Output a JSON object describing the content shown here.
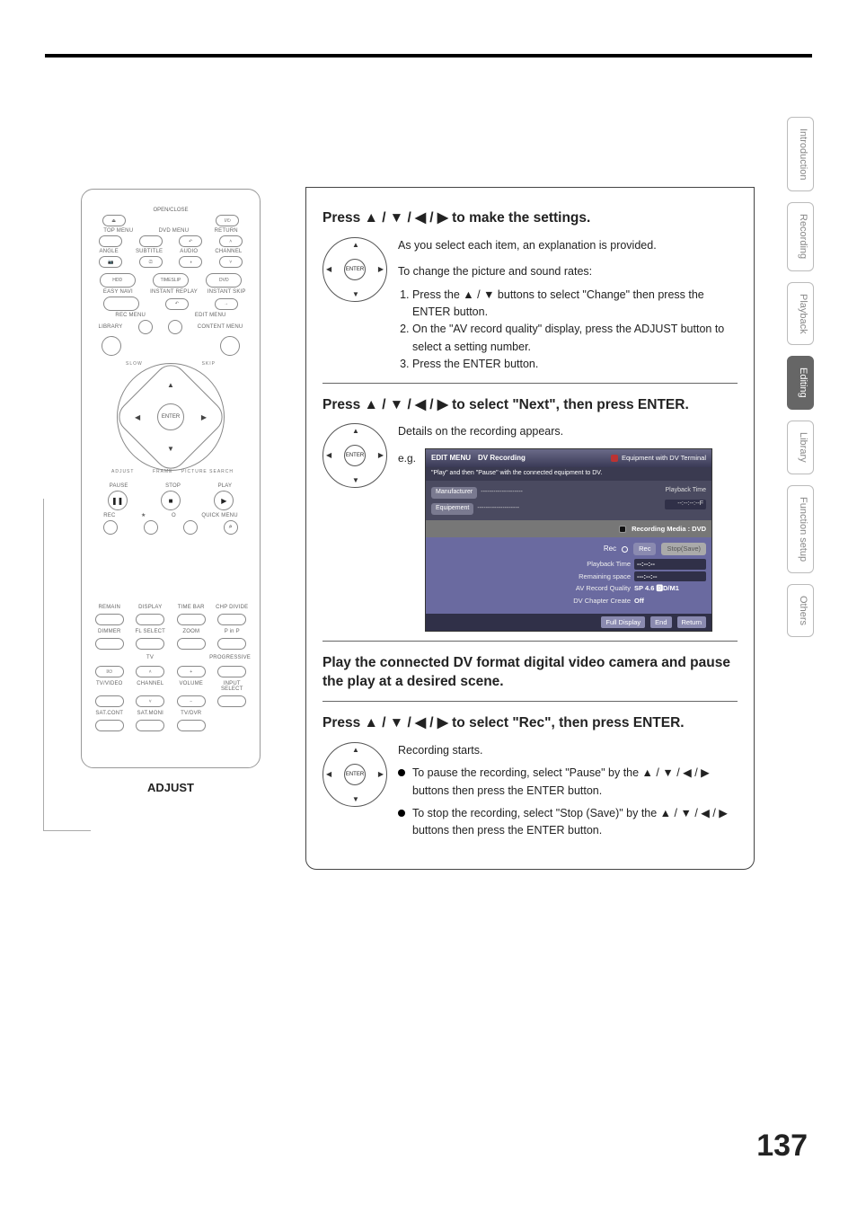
{
  "page_number": "137",
  "tabs": [
    "Introduction",
    "Recording",
    "Playback",
    "Editing",
    "Library",
    "Function setup",
    "Others"
  ],
  "active_tab_index": 3,
  "adjust_label": "ADJUST",
  "enter_label": "ENTER",
  "remote": {
    "open_close": "OPEN/CLOSE",
    "top_menu": "TOP MENU",
    "dvd_menu": "DVD MENU",
    "return": "RETURN",
    "angle": "ANGLE",
    "subtitle": "SUBTITLE",
    "audio": "AUDIO",
    "channel": "CHANNEL",
    "hdd": "HDD",
    "timeslip": "TIMESLIP",
    "dvd": "DVD",
    "easy_navi": "EASY NAVI",
    "instant_replay": "INSTANT REPLAY",
    "instant_skip": "INSTANT SKIP",
    "rec_menu": "REC MENU",
    "edit_menu": "EDIT MENU",
    "library": "LIBRARY",
    "content_menu": "CONTENT MENU",
    "ring_slow": "SLOW",
    "ring_skip": "SKIP",
    "ring_adjust": "ADJUST",
    "ring_frame": "FRAME",
    "ring_picsearch": "PICTURE SEARCH",
    "pause": "PAUSE",
    "stop": "STOP",
    "play": "PLAY",
    "rec": "REC",
    "star": "★",
    "open_o": "O",
    "quick_menu": "QUICK MENU",
    "row1": [
      "REMAIN",
      "DISPLAY",
      "TIME BAR",
      "CHP DIVIDE"
    ],
    "row2": [
      "DIMMER",
      "FL SELECT",
      "ZOOM",
      "P in P"
    ],
    "tv": "TV",
    "progressive": "PROGRESSIVE",
    "tv_power": "I/⏻",
    "tv_up": "˄",
    "tv_plus": "+",
    "row3": [
      "TV/VIDEO",
      "CHANNEL",
      "VOLUME",
      "INPUT SELECT"
    ],
    "tv_down": "˅",
    "tv_minus": "−",
    "row4": [
      "SAT.CONT",
      "SAT.MONI",
      "TV/DVR"
    ]
  },
  "steps": {
    "s1": {
      "title_pre": "Press ",
      "title_arrows": "▲ / ▼ / ◀ / ▶",
      "title_post": " to make the settings.",
      "p1": "As you select each item, an explanation is provided.",
      "p2": "To change the picture and sound rates:",
      "li1": "Press the ▲ / ▼ buttons to select \"Change\" then press the ENTER button.",
      "li2": "On the \"AV record quality\" display, press the ADJUST button to select a setting number.",
      "li3": "Press the ENTER button."
    },
    "s2": {
      "title_pre": "Press ",
      "title_arrows": "▲ / ▼ / ◀ / ▶",
      "title_post": " to select \"Next\", then press ENTER.",
      "p1": "Details on the recording appears.",
      "eg": "e.g."
    },
    "s3": {
      "title": "Play the connected DV format digital video camera and pause the play at a desired scene."
    },
    "s4": {
      "title_pre": "Press ",
      "title_arrows": "▲ / ▼ / ◀ / ▶",
      "title_post": " to select \"Rec\", then press ENTER.",
      "p1": "Recording starts.",
      "b1": "To pause the recording, select \"Pause\" by the ▲ / ▼ / ◀ / ▶ buttons then press the ENTER button.",
      "b2": "To stop the recording, select \"Stop (Save)\" by the ▲ / ▼ / ◀ / ▶ buttons then press the ENTER button."
    }
  },
  "osd": {
    "menu_label": "EDIT MENU",
    "title": "DV Recording",
    "equipment_note": "Equipment with DV Terminal",
    "instruction": "\"Play\" and then \"Pause\" with the connected equipment to DV.",
    "manufacturer_label": "Manufacturer",
    "manufacturer_value": "--------------------",
    "equipment_label": "Equipement",
    "equipment_value": "--------------------",
    "playback_time_top_label": "Playback Time",
    "playback_time_top_value": "--:--:--:--F",
    "media_label": "Recording Media : DVD",
    "rec_label": "Rec",
    "rec_btn": "Rec",
    "stop_btn": "Stop(Save)",
    "pb_time_label": "Playback Time",
    "pb_time_value": "--:--:--",
    "remaining_label": "Remaining space",
    "remaining_value": "---:--:--",
    "av_quality_label": "AV Record Quality",
    "av_quality_value": "SP 4.6 🅳D/M1",
    "dv_chapter_label": "DV Chapter Create",
    "dv_chapter_value": "Off",
    "bar_full": "Full Display",
    "bar_end": "End",
    "bar_return": "Return"
  }
}
